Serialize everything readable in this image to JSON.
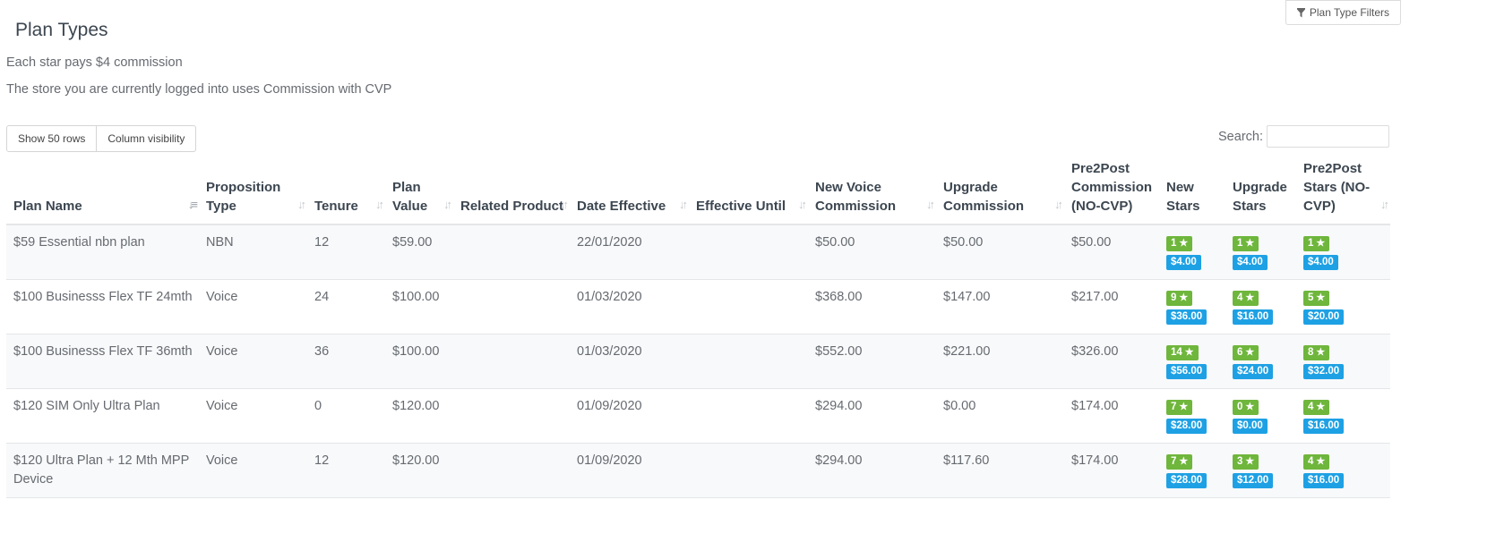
{
  "header": {
    "title": "Plan Types",
    "filters_label": "Plan Type Filters",
    "filters_icon": "funnel-icon"
  },
  "info": {
    "line1": "Each star pays $4 commission",
    "line2": "The store you are currently logged into uses Commission with CVP"
  },
  "toolbar": {
    "show_rows_label": "Show 50 rows",
    "column_visibility_label": "Column visibility",
    "search_label": "Search:",
    "search_value": ""
  },
  "table": {
    "columns": [
      "Plan Name",
      "Proposition Type",
      "Tenure",
      "Plan Value",
      "Related Product",
      "Date Effective",
      "Effective Until",
      "New Voice Commission",
      "Upgrade Commission",
      "Pre2Post Commission (NO-CVP)",
      "New Stars",
      "Upgrade Stars",
      "Pre2Post Stars (NO-CVP)"
    ],
    "sort_icon": "sort-arrows-icon",
    "star_icon": "star-icon",
    "rows": [
      {
        "plan_name": "$59 Essential nbn plan",
        "proposition_type": "NBN",
        "tenure": "12",
        "plan_value": "$59.00",
        "related_product": "",
        "date_effective": "22/01/2020",
        "effective_until": "",
        "new_voice_commission": "$50.00",
        "upgrade_commission": "$50.00",
        "pre2post_commission": "$50.00",
        "new_stars": {
          "count": "1",
          "value": "$4.00"
        },
        "upgrade_stars": {
          "count": "1",
          "value": "$4.00"
        },
        "pre2post_stars": {
          "count": "1",
          "value": "$4.00"
        }
      },
      {
        "plan_name": "$100 Businesss Flex TF 24mth",
        "proposition_type": "Voice",
        "tenure": "24",
        "plan_value": "$100.00",
        "related_product": "",
        "date_effective": "01/03/2020",
        "effective_until": "",
        "new_voice_commission": "$368.00",
        "upgrade_commission": "$147.00",
        "pre2post_commission": "$217.00",
        "new_stars": {
          "count": "9",
          "value": "$36.00"
        },
        "upgrade_stars": {
          "count": "4",
          "value": "$16.00"
        },
        "pre2post_stars": {
          "count": "5",
          "value": "$20.00"
        }
      },
      {
        "plan_name": "$100 Businesss Flex TF 36mth",
        "proposition_type": "Voice",
        "tenure": "36",
        "plan_value": "$100.00",
        "related_product": "",
        "date_effective": "01/03/2020",
        "effective_until": "",
        "new_voice_commission": "$552.00",
        "upgrade_commission": "$221.00",
        "pre2post_commission": "$326.00",
        "new_stars": {
          "count": "14",
          "value": "$56.00"
        },
        "upgrade_stars": {
          "count": "6",
          "value": "$24.00"
        },
        "pre2post_stars": {
          "count": "8",
          "value": "$32.00"
        }
      },
      {
        "plan_name": "$120 SIM Only Ultra Plan",
        "proposition_type": "Voice",
        "tenure": "0",
        "plan_value": "$120.00",
        "related_product": "",
        "date_effective": "01/09/2020",
        "effective_until": "",
        "new_voice_commission": "$294.00",
        "upgrade_commission": "$0.00",
        "pre2post_commission": "$174.00",
        "new_stars": {
          "count": "7",
          "value": "$28.00"
        },
        "upgrade_stars": {
          "count": "0",
          "value": "$0.00"
        },
        "pre2post_stars": {
          "count": "4",
          "value": "$16.00"
        }
      },
      {
        "plan_name": "$120 Ultra Plan + 12 Mth MPP Device",
        "proposition_type": "Voice",
        "tenure": "12",
        "plan_value": "$120.00",
        "related_product": "",
        "date_effective": "01/09/2020",
        "effective_until": "",
        "new_voice_commission": "$294.00",
        "upgrade_commission": "$117.60",
        "pre2post_commission": "$174.00",
        "new_stars": {
          "count": "7",
          "value": "$28.00"
        },
        "upgrade_stars": {
          "count": "3",
          "value": "$12.00"
        },
        "pre2post_stars": {
          "count": "4",
          "value": "$16.00"
        }
      }
    ]
  }
}
